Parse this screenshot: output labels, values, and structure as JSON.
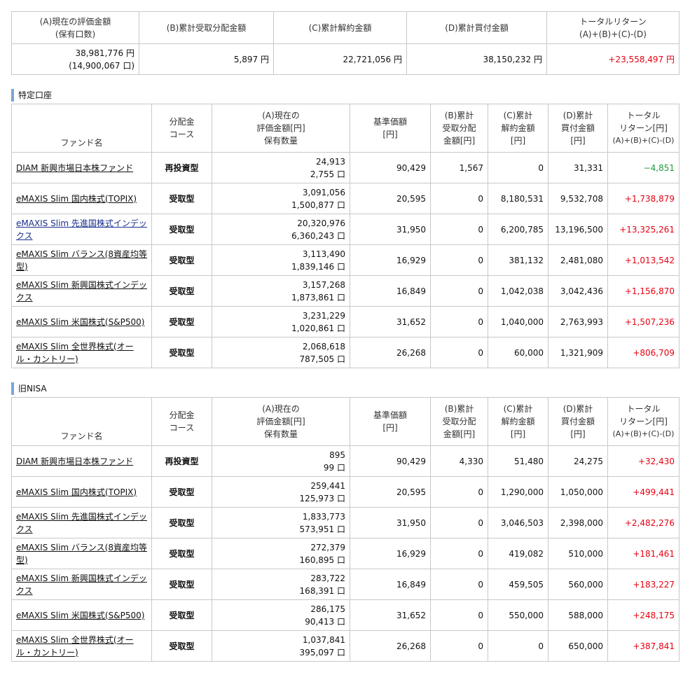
{
  "summary": {
    "headers": [
      "(A)現在の評価金額\n(保有口数)",
      "(B)累計受取分配金額",
      "(C)累計解約金額",
      "(D)累計買付金額",
      "トータルリターン\n(A)+(B)+(C)-(D)"
    ],
    "a_value": "38,981,776 円",
    "a_units": "(14,900,067 口)",
    "b": "5,897 円",
    "c": "22,721,056 円",
    "d": "38,150,232 円",
    "total": "+23,558,497 円"
  },
  "columns": {
    "fund": "ファンド名",
    "course": "分配金\nコース",
    "value": "(A)現在の\n評価金額[円]\n保有数量",
    "nav": "基準価額\n[円]",
    "dist": "(B)累計\n受取分配\n金額[円]",
    "redeem": "(C)累計\n解約金額\n[円]",
    "buy": "(D)累計\n買付金額\n[円]",
    "ret1": "トータル\nリターン[円]",
    "ret2": "(A)+(B)+(C)-(D)"
  },
  "tokutei": {
    "title": "特定口座",
    "rows": [
      {
        "fund": "DIAM 新興市場日本株ファンド",
        "course": "再投資型",
        "value": "24,913",
        "units": "2,755 口",
        "nav": "90,429",
        "dist": "1,567",
        "redeem": "0",
        "buy": "31,331",
        "ret": "−4,851",
        "sign": "neg"
      },
      {
        "fund": "eMAXIS Slim 国内株式(TOPIX)",
        "course": "受取型",
        "value": "3,091,056",
        "units": "1,500,877 口",
        "nav": "20,595",
        "dist": "0",
        "redeem": "8,180,531",
        "buy": "9,532,708",
        "ret": "+1,738,879",
        "sign": "pos"
      },
      {
        "fund": "eMAXIS Slim 先進国株式インデックス",
        "course": "受取型",
        "value": "20,320,976",
        "units": "6,360,243 口",
        "nav": "31,950",
        "dist": "0",
        "redeem": "6,200,785",
        "buy": "13,196,500",
        "ret": "+13,325,261",
        "sign": "pos"
      },
      {
        "fund": "eMAXIS Slim バランス(8資産均等型)",
        "course": "受取型",
        "value": "3,113,490",
        "units": "1,839,146 口",
        "nav": "16,929",
        "dist": "0",
        "redeem": "381,132",
        "buy": "2,481,080",
        "ret": "+1,013,542",
        "sign": "pos"
      },
      {
        "fund": "eMAXIS Slim 新興国株式インデックス",
        "course": "受取型",
        "value": "3,157,268",
        "units": "1,873,861 口",
        "nav": "16,849",
        "dist": "0",
        "redeem": "1,042,038",
        "buy": "3,042,436",
        "ret": "+1,156,870",
        "sign": "pos"
      },
      {
        "fund": "eMAXIS Slim 米国株式(S&P500)",
        "course": "受取型",
        "value": "3,231,229",
        "units": "1,020,861 口",
        "nav": "31,652",
        "dist": "0",
        "redeem": "1,040,000",
        "buy": "2,763,993",
        "ret": "+1,507,236",
        "sign": "pos"
      },
      {
        "fund": "eMAXIS Slim 全世界株式(オール・カントリー)",
        "course": "受取型",
        "value": "2,068,618",
        "units": "787,505 口",
        "nav": "26,268",
        "dist": "0",
        "redeem": "60,000",
        "buy": "1,321,909",
        "ret": "+806,709",
        "sign": "pos"
      }
    ]
  },
  "nisa": {
    "title": "旧NISA",
    "rows": [
      {
        "fund": "DIAM 新興市場日本株ファンド",
        "course": "再投資型",
        "value": "895",
        "units": "99 口",
        "nav": "90,429",
        "dist": "4,330",
        "redeem": "51,480",
        "buy": "24,275",
        "ret": "+32,430",
        "sign": "pos"
      },
      {
        "fund": "eMAXIS Slim 国内株式(TOPIX)",
        "course": "受取型",
        "value": "259,441",
        "units": "125,973 口",
        "nav": "20,595",
        "dist": "0",
        "redeem": "1,290,000",
        "buy": "1,050,000",
        "ret": "+499,441",
        "sign": "pos"
      },
      {
        "fund": "eMAXIS Slim 先進国株式インデックス",
        "course": "受取型",
        "value": "1,833,773",
        "units": "573,951 口",
        "nav": "31,950",
        "dist": "0",
        "redeem": "3,046,503",
        "buy": "2,398,000",
        "ret": "+2,482,276",
        "sign": "pos"
      },
      {
        "fund": "eMAXIS Slim バランス(8資産均等型)",
        "course": "受取型",
        "value": "272,379",
        "units": "160,895 口",
        "nav": "16,929",
        "dist": "0",
        "redeem": "419,082",
        "buy": "510,000",
        "ret": "+181,461",
        "sign": "pos"
      },
      {
        "fund": "eMAXIS Slim 新興国株式インデックス",
        "course": "受取型",
        "value": "283,722",
        "units": "168,391 口",
        "nav": "16,849",
        "dist": "0",
        "redeem": "459,505",
        "buy": "560,000",
        "ret": "+183,227",
        "sign": "pos"
      },
      {
        "fund": "eMAXIS Slim 米国株式(S&P500)",
        "course": "受取型",
        "value": "286,175",
        "units": "90,413 口",
        "nav": "31,652",
        "dist": "0",
        "redeem": "550,000",
        "buy": "588,000",
        "ret": "+248,175",
        "sign": "pos"
      },
      {
        "fund": "eMAXIS Slim 全世界株式(オール・カントリー)",
        "course": "受取型",
        "value": "1,037,841",
        "units": "395,097 口",
        "nav": "26,268",
        "dist": "0",
        "redeem": "0",
        "buy": "650,000",
        "ret": "+387,841",
        "sign": "pos"
      }
    ]
  }
}
